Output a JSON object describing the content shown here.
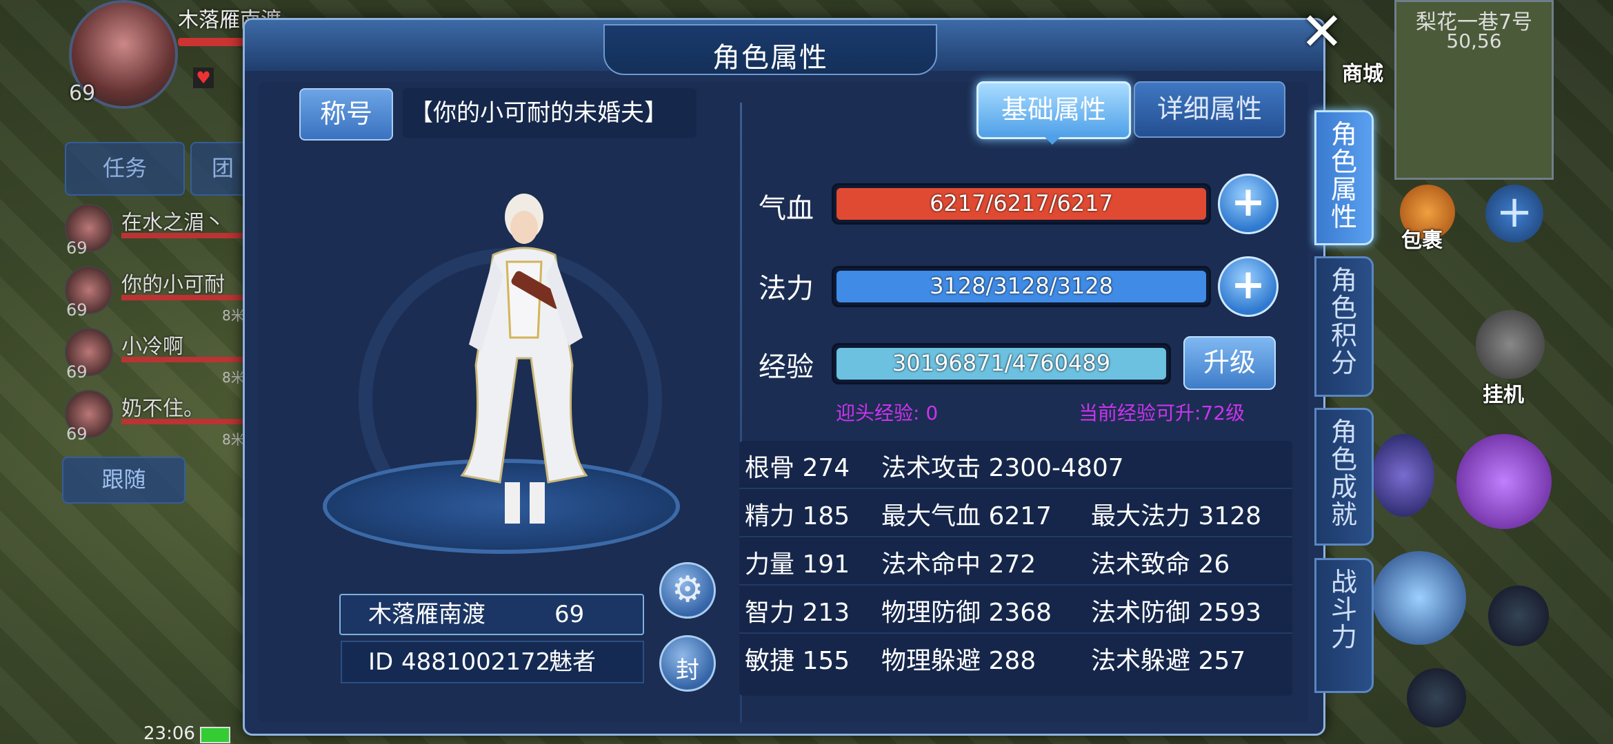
{
  "hud": {
    "player_name": "木落雁南渡",
    "player_level": "69",
    "tabs": [
      "任务",
      "团"
    ],
    "team": [
      {
        "name": "在水之湄丶",
        "level": "69",
        "dist": ""
      },
      {
        "name": "你的小可耐",
        "level": "69",
        "dist": "8米"
      },
      {
        "name": "小冷啊",
        "level": "69",
        "dist": "8米"
      },
      {
        "name": "奶不住。",
        "level": "69",
        "dist": "8米"
      }
    ],
    "follow_label": "跟随",
    "minimap_name": "梨花一巷7号",
    "minimap_coord": "50,56",
    "shop_label": "商城",
    "bag_label": "包裹",
    "idle_label": "挂机",
    "clock": "23:06"
  },
  "modal": {
    "title": "角色属性",
    "close_glyph": "✕",
    "title_button": "称号",
    "title_value": "【你的小可耐的未婚夫】",
    "char_name": "木落雁南渡",
    "char_level": "69",
    "id_label": "ID",
    "id_value": "4881002172",
    "class_name": "魅者",
    "seal_label": "封",
    "tabs": {
      "basic": "基础属性",
      "detail": "详细属性"
    },
    "bars": {
      "hp": {
        "label": "气血",
        "text": "6217/6217/6217",
        "fill": 1.0,
        "color": "#e04a32"
      },
      "mp": {
        "label": "法力",
        "text": "3128/3128/3128",
        "fill": 1.0,
        "color": "#3f8be6"
      },
      "exp": {
        "label": "经验",
        "text": "30196871/4760489",
        "fill": 1.0,
        "color": "#6cc0e0"
      }
    },
    "levelup_label": "升级",
    "exp_notes": {
      "head": "迎头经验: 0",
      "available": "当前经验可升:72级"
    },
    "attrs": [
      [
        "根骨 274",
        "法术攻击 2300-4807",
        ""
      ],
      [
        "精力 185",
        "最大气血 6217",
        "最大法力 3128"
      ],
      [
        "力量 191",
        "法术命中 272",
        "法术致命 26"
      ],
      [
        "智力 213",
        "物理防御 2368",
        "法术防御 2593"
      ],
      [
        "敏捷 155",
        "物理躲避 288",
        "法术躲避 257"
      ]
    ],
    "side_tabs": [
      "角色属性",
      "角色积分",
      "角色成就",
      "战斗力"
    ]
  }
}
